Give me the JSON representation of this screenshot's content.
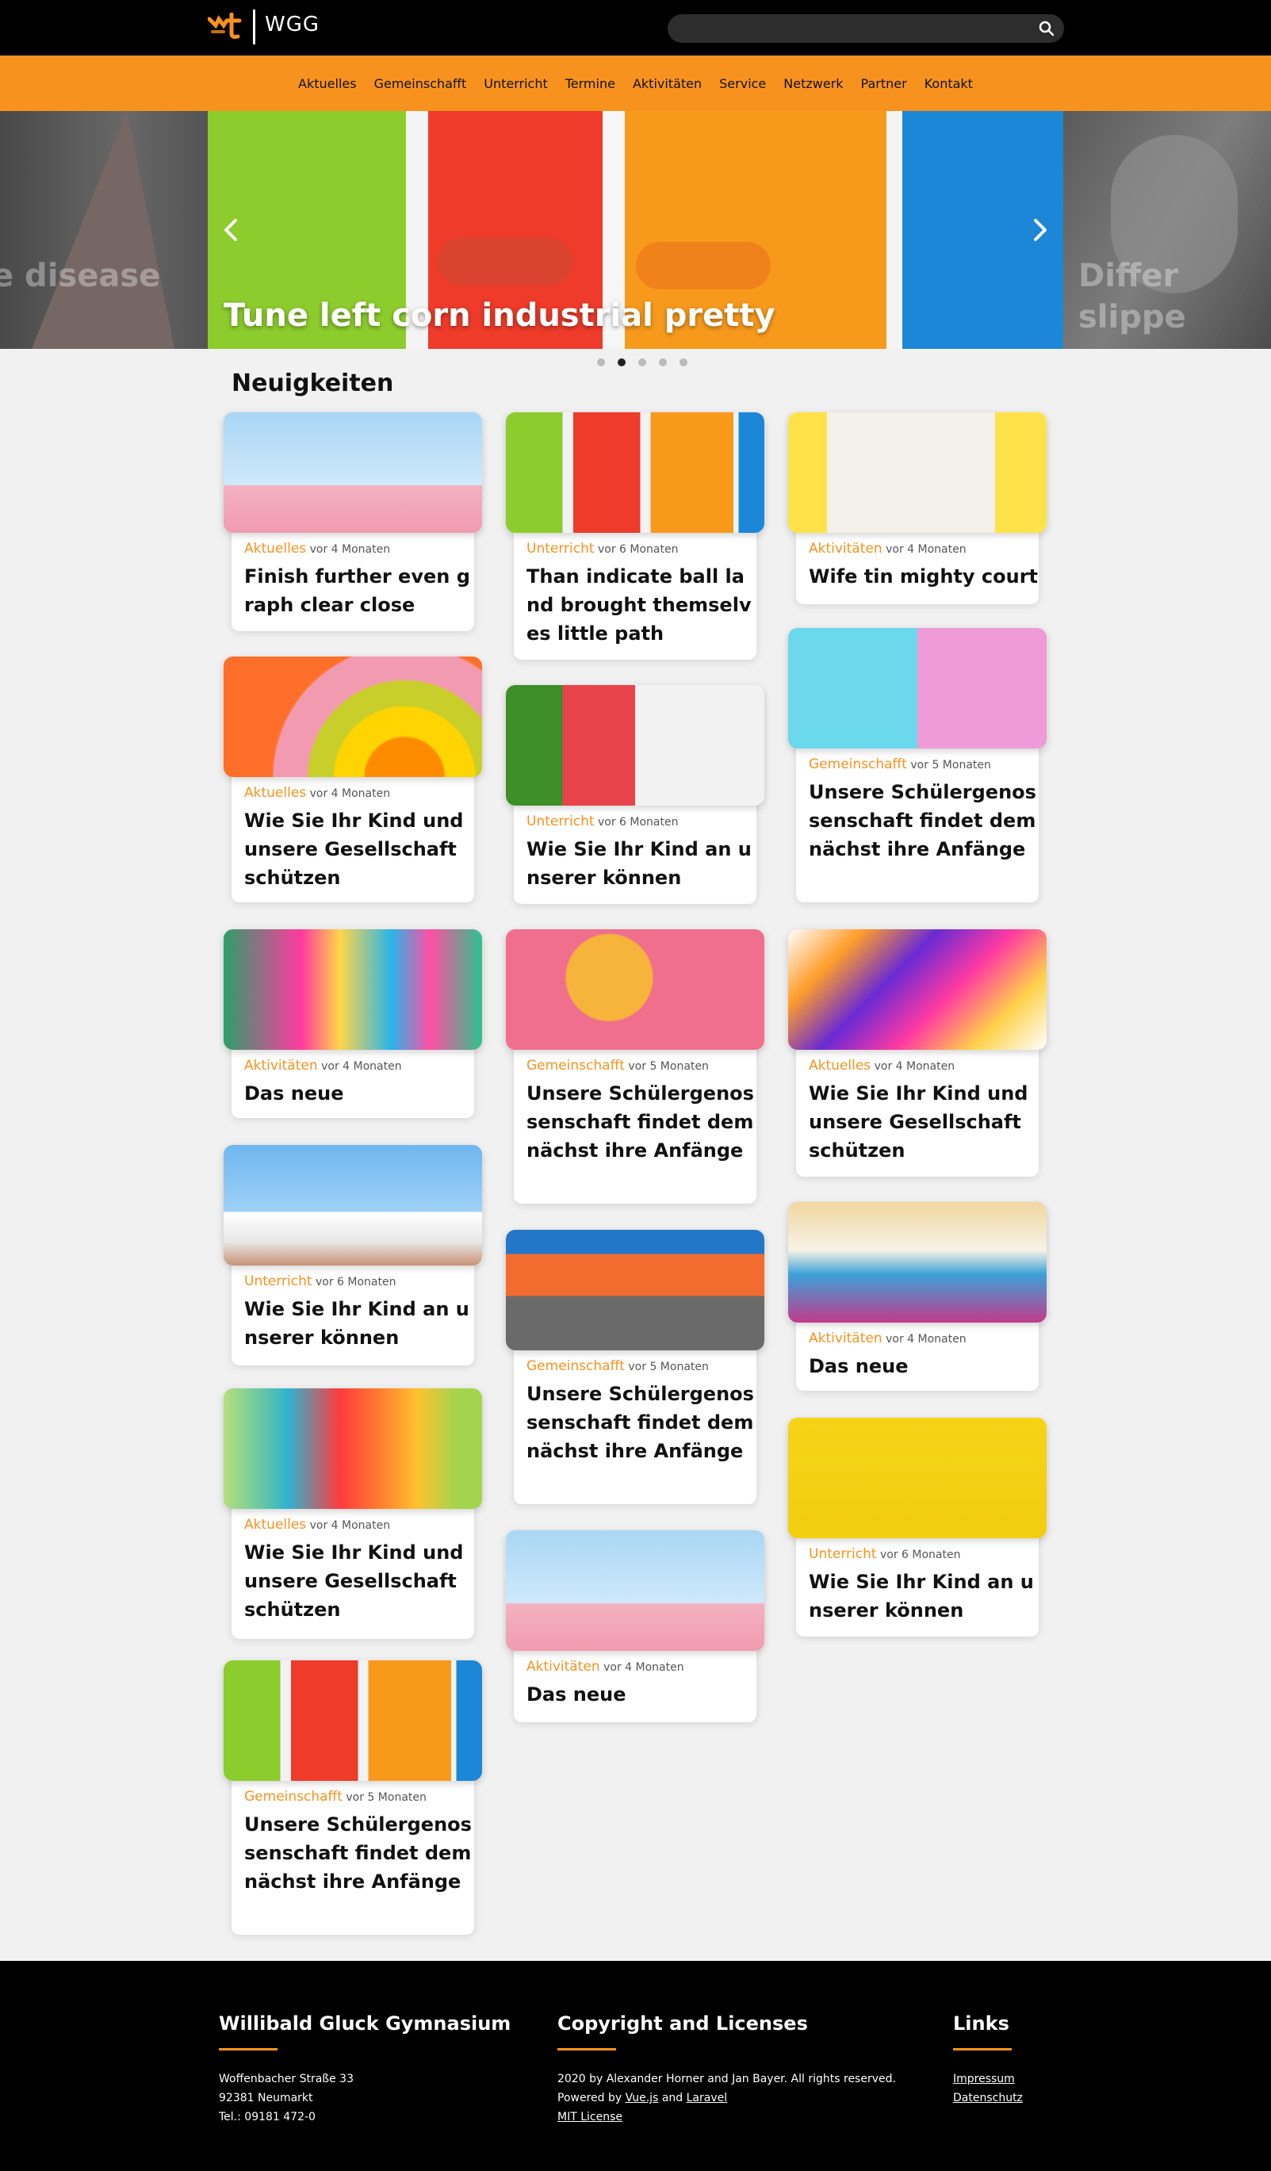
{
  "header": {
    "logo_text": "WGG",
    "search_placeholder": "",
    "search_icon": "search-icon"
  },
  "nav": [
    "Aktuelles",
    "Gemeinschafft",
    "Unterricht",
    "Termine",
    "Aktivitäten",
    "Service",
    "Netzwerk",
    "Partner",
    "Kontakt"
  ],
  "hero": {
    "title": "Tune left corn industrial pretty",
    "prev_text": "e disease",
    "next_text": "Differ slippe support mo",
    "slides_count": 5,
    "active_slide": 2,
    "prev_icon": "chevron-left-icon",
    "next_icon": "chevron-right-icon"
  },
  "section_title": "Neuigkeiten",
  "cards": [
    {
      "category": "Aktuelles",
      "time": "vor 4 Monaten",
      "title": "Finish further even graph clear close"
    },
    {
      "category": "Aktuelles",
      "time": "vor 4 Monaten",
      "title": "Wie Sie Ihr Kind und unsere Gesellschaft schützen"
    },
    {
      "category": "Aktivitäten",
      "time": "vor 4 Monaten",
      "title": "Das neue"
    },
    {
      "category": "Unterricht",
      "time": "vor 6 Monaten",
      "title": "Wie Sie Ihr Kind an unserer können"
    },
    {
      "category": "Aktuelles",
      "time": "vor 4 Monaten",
      "title": "Wie Sie Ihr Kind und unsere Gesellschaft schützen"
    },
    {
      "category": "Gemeinschafft",
      "time": "vor 5 Monaten",
      "title": "Unsere Schülergenossenschaft findet demnächst ihre Anfänge"
    },
    {
      "category": "Unterricht",
      "time": "vor 6 Monaten",
      "title": "Than indicate ball land brought themselves little path"
    },
    {
      "category": "Unterricht",
      "time": "vor 6 Monaten",
      "title": "Wie Sie Ihr Kind an unserer können"
    },
    {
      "category": "Gemeinschafft",
      "time": "vor 5 Monaten",
      "title": "Unsere Schülergenossenschaft findet demnächst ihre Anfänge"
    },
    {
      "category": "Gemeinschafft",
      "time": "vor 5 Monaten",
      "title": "Unsere Schülergenossenschaft findet demnächst ihre Anfänge"
    },
    {
      "category": "Aktivitäten",
      "time": "vor 4 Monaten",
      "title": "Das neue"
    },
    {
      "category": "Aktivitäten",
      "time": "vor 4 Monaten",
      "title": "Wife tin mighty court"
    },
    {
      "category": "Gemeinschafft",
      "time": "vor 5 Monaten",
      "title": "Unsere Schülergenossenschaft findet demnächst ihre Anfänge"
    },
    {
      "category": "Aktuelles",
      "time": "vor 4 Monaten",
      "title": "Wie Sie Ihr Kind und unsere Gesellschaft schützen"
    },
    {
      "category": "Aktivitäten",
      "time": "vor 4 Monaten",
      "title": "Das neue"
    },
    {
      "category": "Unterricht",
      "time": "vor 6 Monaten",
      "title": "Wie Sie Ihr Kind an unserer können"
    }
  ],
  "footer": {
    "school": {
      "heading": "Willibald Gluck Gymnasium",
      "street": "Woffenbacher Straße 33",
      "city": "92381 Neumarkt",
      "phone": "Tel.: 09181 472-0"
    },
    "copyright": {
      "heading": "Copyright and Licenses",
      "line1": "2020 by Alexander Horner and Jan Bayer. All rights reserved.",
      "powered_prefix": "Powered by",
      "vue": "Vue.js",
      "and": "and",
      "laravel": "Laravel",
      "license": "MIT License"
    },
    "links": {
      "heading": "Links",
      "impressum": "Impressum",
      "datenschutz": "Datenschutz"
    }
  },
  "colors": {
    "accent": "#f8921e",
    "topbar": "#000000",
    "footer": "#000000",
    "background": "#f1f1f1"
  }
}
